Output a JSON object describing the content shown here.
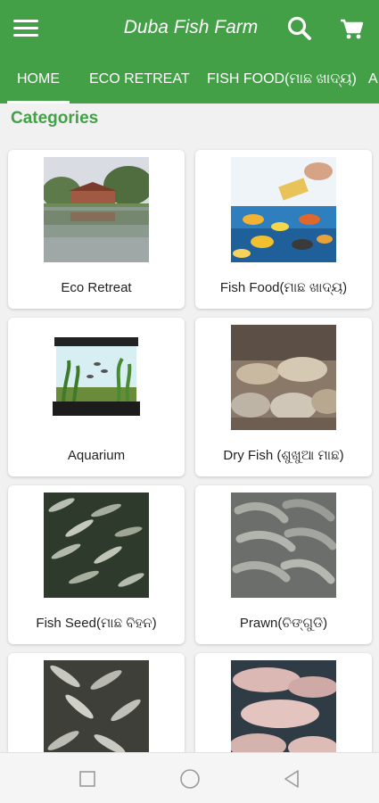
{
  "app": {
    "title": "Duba Fish Farm",
    "accent_color": "#43a047",
    "icons": {
      "menu": "hamburger-menu-icon",
      "search": "search-icon",
      "cart": "cart-icon"
    }
  },
  "tabs": [
    {
      "label": "HOME",
      "active": true
    },
    {
      "label": "ECO RETREAT"
    },
    {
      "label": "FISH FOOD(ମାଛ ଖାଦ୍ୟ)"
    },
    {
      "label": "A"
    }
  ],
  "section_title": "Categories",
  "categories": [
    {
      "label": "Eco Retreat",
      "image": "lake-resort-photo"
    },
    {
      "label": "Fish Food(ମାଛ ଖାଦ୍ୟ)",
      "image": "fish-food-photo"
    },
    {
      "label": "Aquarium",
      "image": "aquarium-tank-photo"
    },
    {
      "label": "Dry Fish (ଶୁଖୁଆ ମାଛ)",
      "image": "dry-fish-baskets-photo"
    },
    {
      "label": "Fish Seed(ମାଛ ବିହନ)",
      "image": "fish-fingerlings-photo"
    },
    {
      "label": "Prawn(ଚିଙ୍ଗୁଡି)",
      "image": "prawns-photo"
    },
    {
      "label": "",
      "image": "small-fish-photo"
    },
    {
      "label": "",
      "image": "large-fish-photo"
    }
  ],
  "system_nav": {
    "recents": "square-icon",
    "home": "circle-icon",
    "back": "triangle-back-icon"
  }
}
